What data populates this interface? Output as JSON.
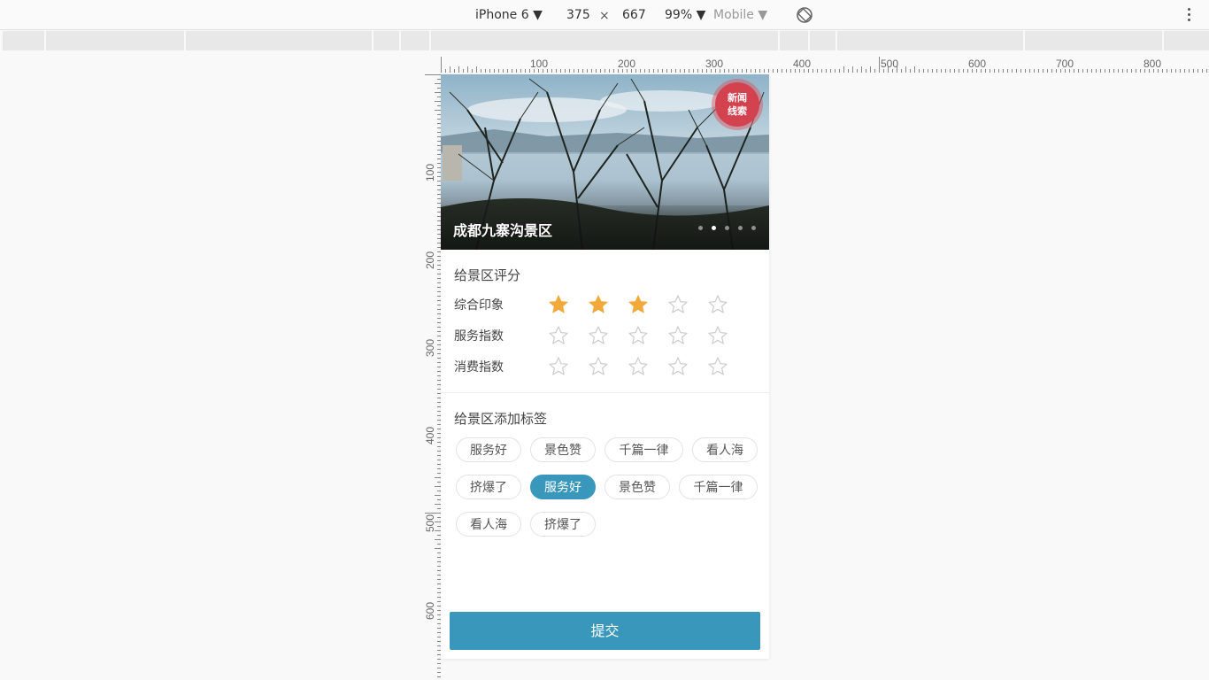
{
  "devtools": {
    "device": "iPhone 6",
    "width": "375",
    "times": "×",
    "height": "667",
    "zoom": "99%",
    "mode": "Mobile"
  },
  "rulers": {
    "horizontal": [
      "100",
      "200",
      "300",
      "400",
      "500",
      "600",
      "700",
      "800"
    ],
    "vertical": [
      "100",
      "200",
      "300",
      "400",
      "500",
      "600"
    ]
  },
  "banner": {
    "title": "成都九寨沟景区",
    "badge_line1": "新闻",
    "badge_line2": "线索",
    "slide_count": 5,
    "active_slide": 2
  },
  "rating_section": {
    "title": "给景区评分",
    "rows": [
      {
        "label": "综合印象",
        "rating": 3,
        "max": 5
      },
      {
        "label": "服务指数",
        "rating": 0,
        "max": 5
      },
      {
        "label": "消费指数",
        "rating": 0,
        "max": 5
      }
    ]
  },
  "tags_section": {
    "title": "给景区添加标签",
    "tags": [
      {
        "label": "服务好",
        "selected": false
      },
      {
        "label": "景色赞",
        "selected": false
      },
      {
        "label": "千篇一律",
        "selected": false
      },
      {
        "label": "看人海",
        "selected": false
      },
      {
        "label": "挤爆了",
        "selected": false
      },
      {
        "label": "服务好",
        "selected": true
      },
      {
        "label": "景色赞",
        "selected": false
      },
      {
        "label": "千篇一律",
        "selected": false
      },
      {
        "label": "看人海",
        "selected": false
      },
      {
        "label": "挤爆了",
        "selected": false
      }
    ]
  },
  "submit_label": "提交",
  "colors": {
    "accent": "#3a97bc",
    "star_filled": "#f2a93b",
    "star_empty": "#cccccc",
    "badge": "#d2434f"
  }
}
